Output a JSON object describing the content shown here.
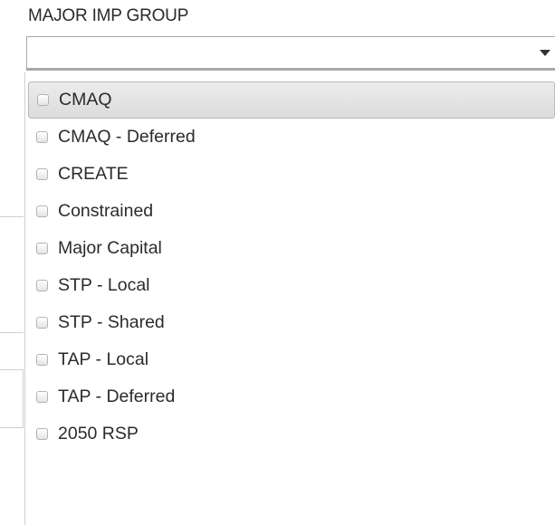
{
  "filter": {
    "label": "MAJOR IMP GROUP",
    "selected_value": "",
    "options": [
      {
        "label": "CMAQ",
        "checked": false,
        "highlighted": true
      },
      {
        "label": "CMAQ - Deferred",
        "checked": false,
        "highlighted": false
      },
      {
        "label": "CREATE",
        "checked": false,
        "highlighted": false
      },
      {
        "label": "Constrained",
        "checked": false,
        "highlighted": false
      },
      {
        "label": "Major Capital",
        "checked": false,
        "highlighted": false
      },
      {
        "label": "STP - Local",
        "checked": false,
        "highlighted": false
      },
      {
        "label": "STP - Shared",
        "checked": false,
        "highlighted": false
      },
      {
        "label": "TAP - Local",
        "checked": false,
        "highlighted": false
      },
      {
        "label": "TAP - Deferred",
        "checked": false,
        "highlighted": false
      },
      {
        "label": "2050 RSP",
        "checked": false,
        "highlighted": false
      }
    ]
  },
  "icons": {
    "dropdown_toggle": "caret-down-icon",
    "option_checkbox": "checkbox-icon"
  },
  "colors": {
    "highlight_bg": "#e3e3e3",
    "border": "#a8a8a8",
    "text": "#2b2b2b"
  }
}
